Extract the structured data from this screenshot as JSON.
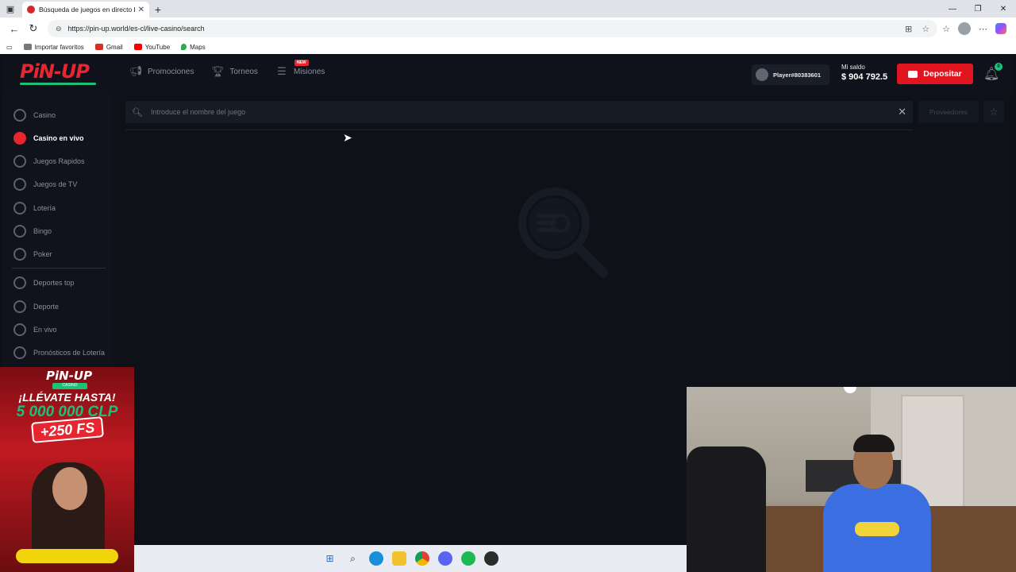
{
  "browser": {
    "tab_title": "Búsqueda de juegos en directo P",
    "url": "https://pin-up.world/es-cl/live-casino/search",
    "bookmarks": [
      "Importar favoritos",
      "Gmail",
      "YouTube",
      "Maps"
    ]
  },
  "header": {
    "logo": "PiN-UP",
    "nav": [
      {
        "label": "Promociones",
        "icon": "megaphone-icon"
      },
      {
        "label": "Torneos",
        "icon": "trophy-icon"
      },
      {
        "label": "Misiones",
        "icon": "missions-icon",
        "badge": "NEW"
      }
    ],
    "player_name": "Player#80383601",
    "balance_label": "Mi saldo",
    "balance_value": "$ 904 792.5",
    "deposit_label": "Depositar",
    "notifications_count": "0"
  },
  "sidebar": {
    "items": [
      {
        "label": "Casino",
        "icon": "casino-chip-icon"
      },
      {
        "label": "Casino en vivo",
        "icon": "live-dealer-icon",
        "active": true
      },
      {
        "label": "Juegos Rapidos",
        "icon": "rocket-icon"
      },
      {
        "label": "Juegos de TV",
        "icon": "tv-icon"
      },
      {
        "label": "Lotería",
        "icon": "lottery-icon"
      },
      {
        "label": "Bingo",
        "icon": "bingo-icon"
      },
      {
        "label": "Poker",
        "icon": "cards-icon"
      },
      {
        "label": "Deportes top",
        "icon": "trophy-icon"
      },
      {
        "label": "Deporte",
        "icon": "soccer-ball-icon"
      },
      {
        "label": "En vivo",
        "icon": "live-icon"
      },
      {
        "label": "Pronósticos de Lotería",
        "icon": "lottery-forecast-icon"
      }
    ]
  },
  "search": {
    "placeholder": "Introduce el nombre del juego",
    "value": "",
    "providers_label": "Proveedores"
  },
  "ad": {
    "logo": "PiN-UP",
    "sub": "CASINO",
    "line1": "¡LLÉVATE HASTA!",
    "line2": "5 000 000 CLP",
    "line3": "+250 FS"
  },
  "colors": {
    "accent_red": "#e0151f",
    "accent_green": "#1fbf7a",
    "page_bg": "#0e1118"
  }
}
